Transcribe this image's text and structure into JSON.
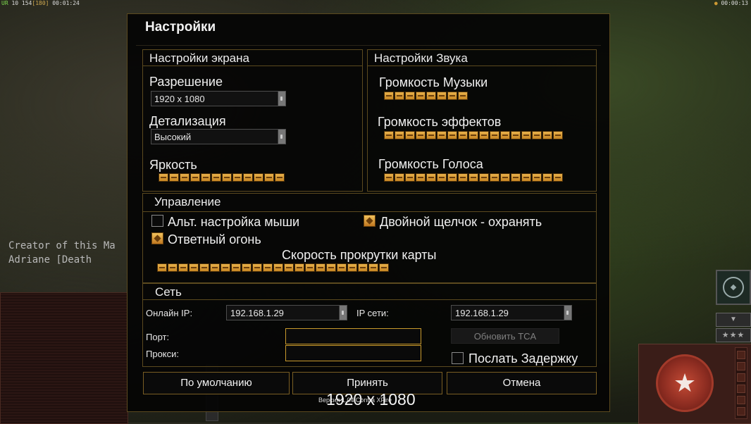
{
  "hud": {
    "top_left": {
      "prefix": "UR",
      "values": "10 154",
      "bracket": "[180]",
      "time": "00:01:24"
    },
    "top_right_time": "00:00:13"
  },
  "map_text": {
    "line1": "Creator of this Ma",
    "line2": "Adriane [Death"
  },
  "dialog": {
    "title": "Настройки",
    "screen": {
      "heading": "Настройки экрана",
      "resolution_label": "Разрешение",
      "resolution_value": "1920 x 1080",
      "detail_label": "Детализация",
      "detail_value": "Высокий",
      "brightness_label": "Яркость",
      "brightness_level": 12,
      "brightness_max": 12
    },
    "sound": {
      "heading": "Настройки Звука",
      "music_label": "Громкость Музыки",
      "music_level": 8,
      "effects_label": "Громкость эффектов",
      "effects_level": 17,
      "voice_label": "Громкость Голоса",
      "voice_level": 17
    },
    "control": {
      "heading": "Управление",
      "alt_mouse_label": "Альт. настройка мыши",
      "alt_mouse_checked": false,
      "double_click_label": "Двойной щелчок - охранять",
      "double_click_checked": true,
      "return_fire_label": "Ответный огонь",
      "return_fire_checked": true,
      "scroll_label": "Скорость прокрутки карты",
      "scroll_level": 22
    },
    "network": {
      "heading": "Сеть",
      "online_ip_label": "Онлайн IP:",
      "online_ip_value": "192.168.1.29",
      "lan_ip_label": "IP сети:",
      "lan_ip_value": "192.168.1.29",
      "port_label": "Порт:",
      "proxy_label": "Прокси:",
      "port_value": "",
      "proxy_value": "",
      "update_button": "Обновить TCA",
      "send_delay_label": "Послать Задержку",
      "send_delay_checked": false
    },
    "buttons": {
      "default": "По умолчанию",
      "accept": "Принять",
      "cancel": "Отмена"
    }
  },
  "overlay": {
    "resolution_text": "1920 x 1080",
    "version_text": "Версия 1.04 Contra XFire"
  },
  "colors": {
    "accent_gold": "#c99a2c",
    "frame": "#5c4a1f",
    "slider_orange": "#e0a23e"
  }
}
